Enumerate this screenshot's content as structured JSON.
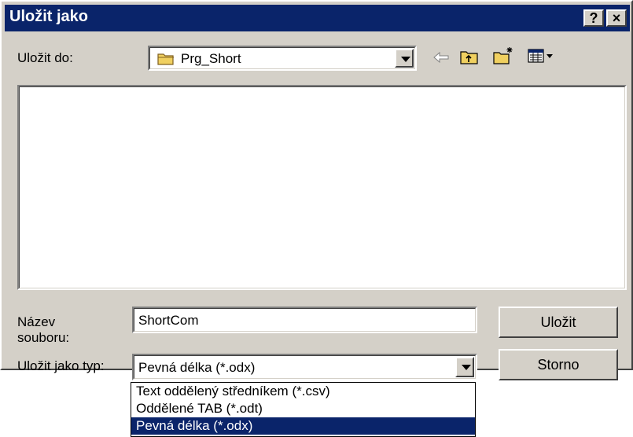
{
  "window": {
    "title": "Uložit jako",
    "help_label": "?",
    "close_label": "×"
  },
  "save_in": {
    "label": "Uložit do:",
    "value": "Prg_Short"
  },
  "toolbar": [
    "back-icon",
    "up-folder-icon",
    "new-folder-icon",
    "view-menu-icon"
  ],
  "filename": {
    "label_line1": "Název",
    "label_line2": "souboru:",
    "value": "ShortCom"
  },
  "filetype": {
    "label": "Uložit jako typ:",
    "value": "Pevná délka (*.odx)"
  },
  "buttons": {
    "save": "Uložit",
    "cancel": "Storno"
  },
  "filetype_options": [
    "Text oddělený středníkem (*.csv)",
    "Oddělené TAB (*.odt)",
    "Pevná délka (*.odx)"
  ],
  "selected_option_index": 2
}
